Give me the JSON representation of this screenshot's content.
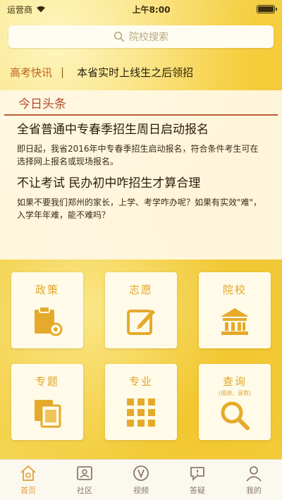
{
  "status": {
    "carrier": "运营商",
    "time": "上午8:00"
  },
  "search": {
    "placeholder": "院校搜索"
  },
  "ticker": {
    "label": "高考快讯",
    "separator": "|",
    "text": "本省实时上线生之后领招"
  },
  "news": {
    "header": "今日头条",
    "articles": [
      {
        "title": "全省普通中专春季招生周日启动报名",
        "summary": "即日起，我省2016年中专春季招生启动报名，符合条件考生可在选择网上报名或现场报名。"
      },
      {
        "title": "不让考试 民办初中咋招生才算合理",
        "summary": "如果不要我们郑州的家长，上学、考学咋办呢？如果有实效\"难\"，入学年年难，能不难吗？"
      }
    ]
  },
  "grid": {
    "tiles": [
      {
        "label": "政策",
        "icon": "clipboard-icon"
      },
      {
        "label": "志愿",
        "icon": "edit-icon"
      },
      {
        "label": "院校",
        "icon": "school-building-icon"
      },
      {
        "label": "专题",
        "icon": "documents-icon"
      },
      {
        "label": "专业",
        "icon": "grid-apps-icon"
      },
      {
        "label": "查询",
        "sub": "(成绩、录取)",
        "icon": "search-icon"
      }
    ]
  },
  "tabs": [
    {
      "label": "首页",
      "icon": "home-icon"
    },
    {
      "label": "社区",
      "icon": "community-icon"
    },
    {
      "label": "视频",
      "icon": "video-icon"
    },
    {
      "label": "答疑",
      "icon": "qa-icon"
    },
    {
      "label": "我的",
      "icon": "profile-icon"
    }
  ],
  "colors": {
    "accent": "#e2a52a",
    "headline": "#b24a2a",
    "background": "#f3d24a"
  }
}
